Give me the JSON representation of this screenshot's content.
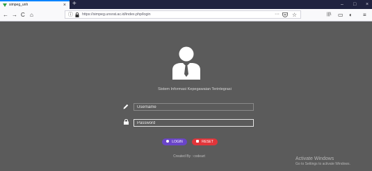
{
  "browser": {
    "tab_title": "simpeg_unh",
    "tab_close": "×",
    "new_tab": "+",
    "window_controls": [
      "–",
      "□",
      "×"
    ],
    "nav_icons": [
      "←",
      "→",
      "C",
      "⌂"
    ],
    "url": "https://simpeg.unsrat.ac.id/index.php/login",
    "page_actions": "···",
    "toolbar_icons": [
      "|||\\",
      "▭",
      "◐",
      "≡"
    ]
  },
  "login": {
    "app_title": "Sistem Informasi Kepegawaian Terintegrasi",
    "username_placeholder": "Username",
    "password_placeholder": "Password",
    "login_label": "LOGIN",
    "reset_label": "RESET",
    "footer": "Created By : codeart"
  },
  "watermark": {
    "line1": "Activate Windows",
    "line2": "Go to Settings to activate Windows."
  },
  "colors": {
    "page_bg": "#5b5b5b",
    "login_button": "#6a45c8",
    "reset_button": "#e0353a",
    "titlebar": "#202340"
  }
}
